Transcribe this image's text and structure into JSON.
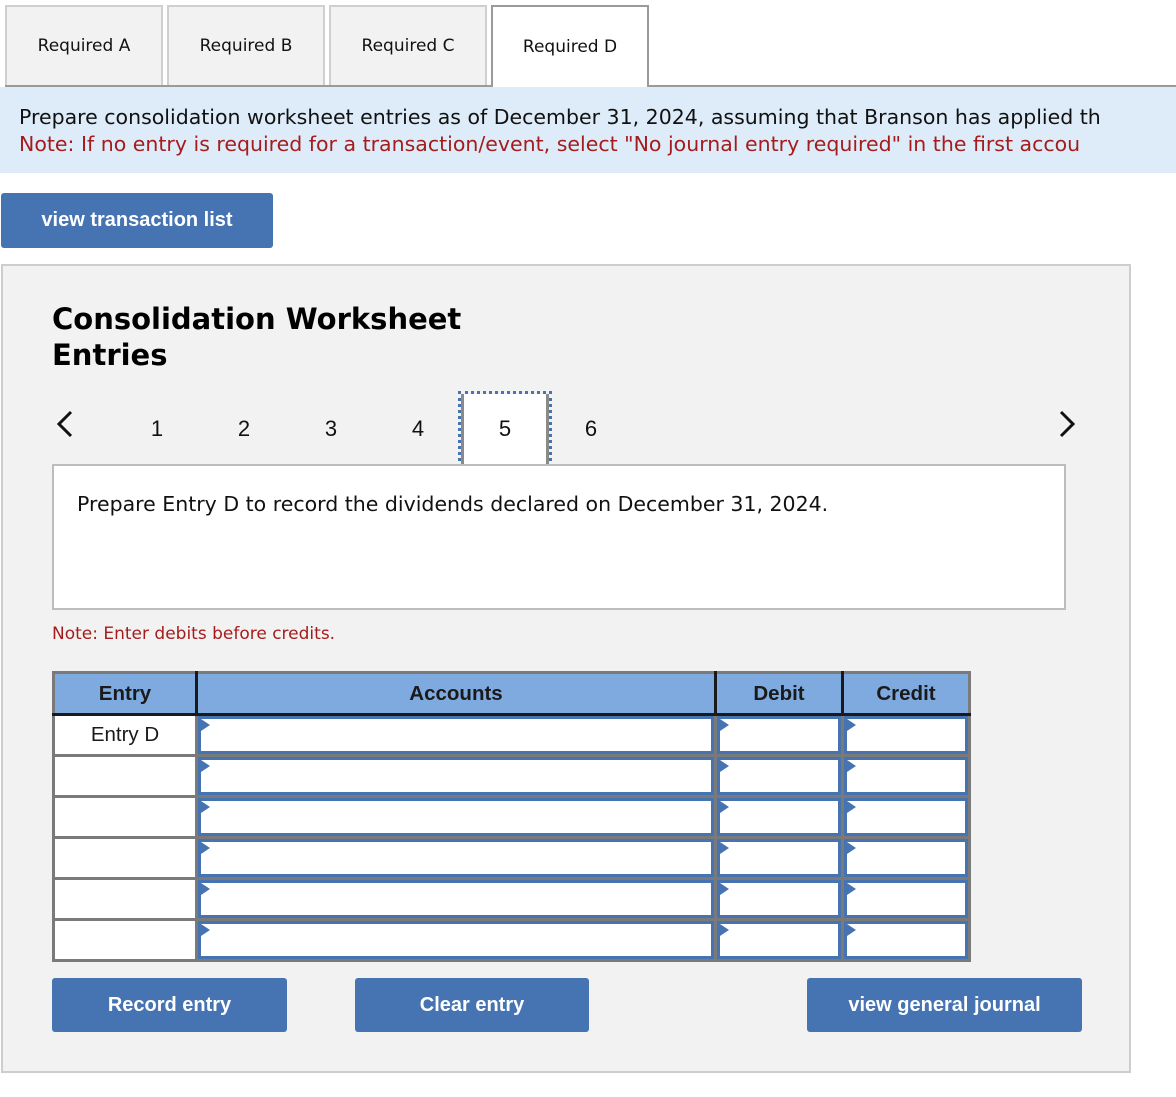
{
  "tabs": [
    {
      "label": "Required A",
      "active": false
    },
    {
      "label": "Required B",
      "active": false
    },
    {
      "label": "Required C",
      "active": false
    },
    {
      "label": "Required D",
      "active": true
    }
  ],
  "banner": {
    "instruction": "Prepare consolidation worksheet entries as of December 31, 2024, assuming that Branson has applied th",
    "note": "Note: If no entry is required for a transaction/event, select \"No journal entry required\" in the first accou"
  },
  "buttons": {
    "view_transaction_list": "view transaction list",
    "record_entry": "Record entry",
    "clear_entry": "Clear entry",
    "view_general_journal": "view general journal"
  },
  "panel": {
    "title": "Consolidation Worksheet Entries",
    "pager": {
      "prev_icon": "chevron-left-icon",
      "next_icon": "chevron-right-icon",
      "pages": [
        "1",
        "2",
        "3",
        "4",
        "5",
        "6"
      ],
      "current_page": "5"
    },
    "question": "Prepare Entry D to record the dividends declared on December 31, 2024.",
    "note": "Note: Enter debits before credits.",
    "table": {
      "headers": [
        "Entry",
        "Accounts",
        "Debit",
        "Credit"
      ],
      "rows": [
        {
          "entry": "Entry D",
          "account": "",
          "debit": "",
          "credit": ""
        },
        {
          "entry": "",
          "account": "",
          "debit": "",
          "credit": ""
        },
        {
          "entry": "",
          "account": "",
          "debit": "",
          "credit": ""
        },
        {
          "entry": "",
          "account": "",
          "debit": "",
          "credit": ""
        },
        {
          "entry": "",
          "account": "",
          "debit": "",
          "credit": ""
        },
        {
          "entry": "",
          "account": "",
          "debit": "",
          "credit": ""
        }
      ]
    }
  },
  "colors": {
    "accent_button": "#4674b3",
    "banner_bg": "#ddecf8",
    "note_red": "#a51c1c",
    "table_header_bg": "#7eaadf",
    "panel_bg": "#f2f2f2"
  }
}
